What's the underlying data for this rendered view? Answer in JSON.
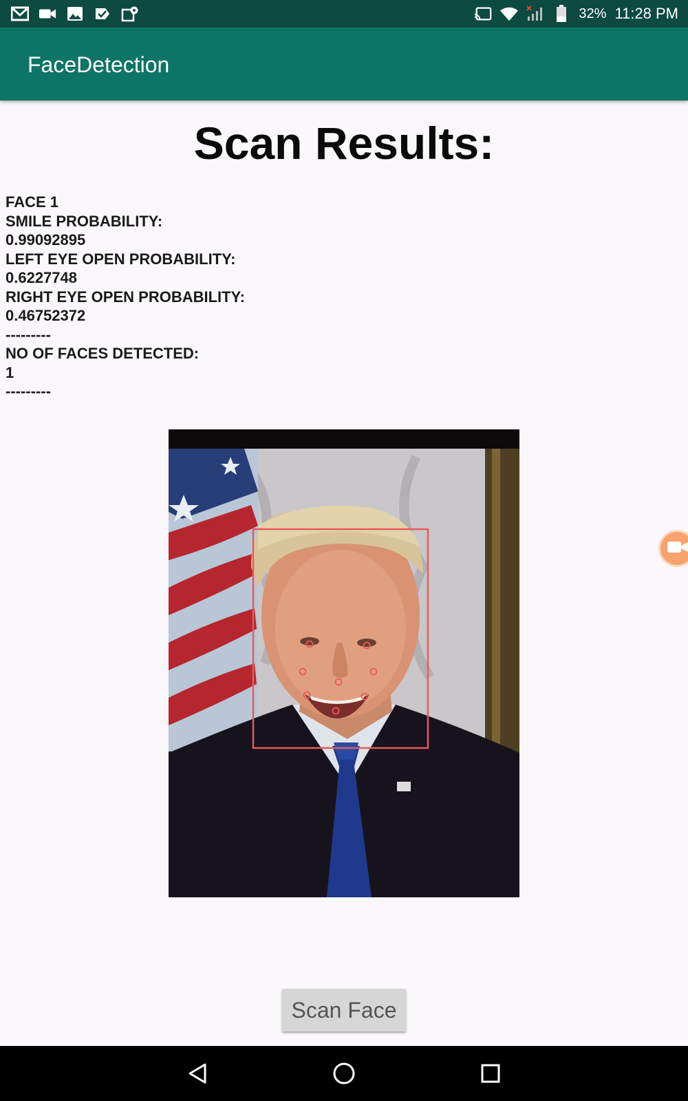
{
  "status_bar": {
    "left_icons": [
      "gmail-icon",
      "video-icon",
      "gallery-icon",
      "check-icon",
      "maps-icon"
    ],
    "battery_percent": "32%",
    "time": "11:28 PM"
  },
  "app_bar": {
    "title": "FaceDetection"
  },
  "main": {
    "heading": "Scan Results:",
    "results": [
      "FACE 1",
      "SMILE PROBABILITY:",
      "0.99092895",
      "LEFT EYE OPEN PROBABILITY:",
      "0.6227748",
      "RIGHT EYE OPEN PROBABILITY:",
      "0.46752372",
      "---------",
      "NO OF FACES DETECTED:",
      "1",
      "---------"
    ],
    "scan_button_label": "Scan Face"
  },
  "colors": {
    "status_bar": "#0d4a40",
    "app_bar": "#0d7565",
    "face_box": "#e85a5a",
    "floating_button": "#f7a36e"
  }
}
